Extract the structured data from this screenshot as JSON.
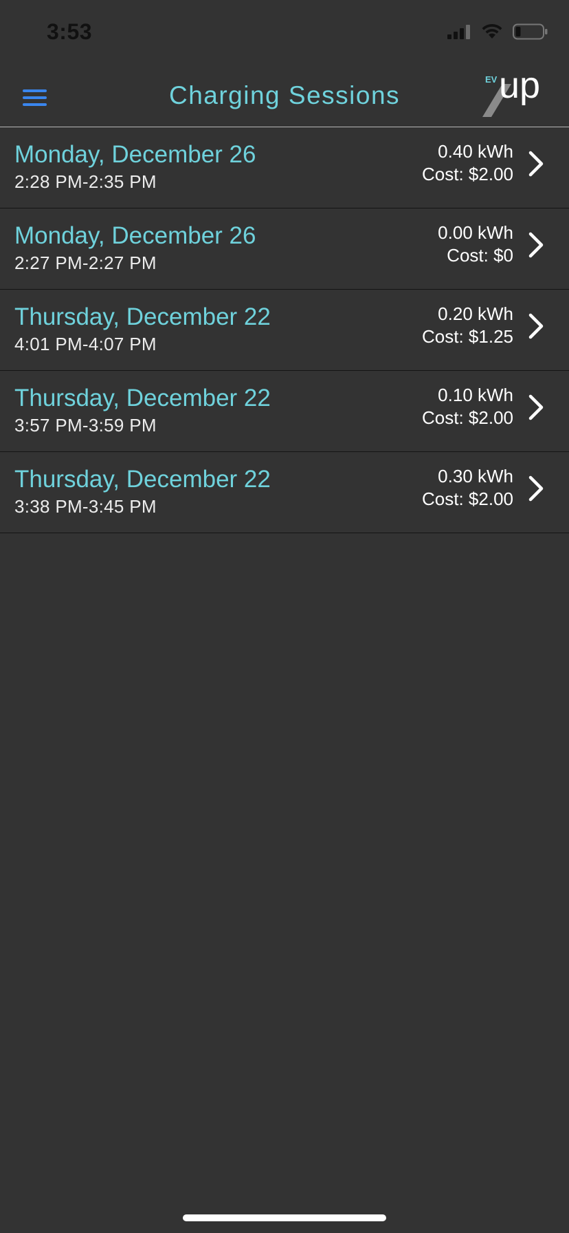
{
  "status_bar": {
    "time": "3:53",
    "icons": [
      "cellular-signal-icon",
      "wifi-icon",
      "battery-icon"
    ]
  },
  "header": {
    "title": "Charging Sessions",
    "menu_icon": "hamburger-menu-icon",
    "logo": {
      "small_text": "EV",
      "large_text": "up"
    }
  },
  "sessions": [
    {
      "date": "Monday, December 26",
      "time_range": "2:28 PM-2:35 PM",
      "energy": "0.40 kWh",
      "cost": "Cost: $2.00"
    },
    {
      "date": "Monday, December 26",
      "time_range": "2:27 PM-2:27 PM",
      "energy": "0.00 kWh",
      "cost": "Cost: $0"
    },
    {
      "date": "Thursday, December 22",
      "time_range": "4:01 PM-4:07 PM",
      "energy": "0.20 kWh",
      "cost": "Cost: $1.25"
    },
    {
      "date": "Thursday, December 22",
      "time_range": "3:57 PM-3:59 PM",
      "energy": "0.10 kWh",
      "cost": "Cost: $2.00"
    },
    {
      "date": "Thursday, December 22",
      "time_range": "3:38 PM-3:45 PM",
      "energy": "0.30 kWh",
      "cost": "Cost: $2.00"
    }
  ],
  "colors": {
    "background": "#333333",
    "accent_teal": "#6fd2dc",
    "menu_blue": "#3a86ee",
    "text_white": "#ffffff"
  }
}
